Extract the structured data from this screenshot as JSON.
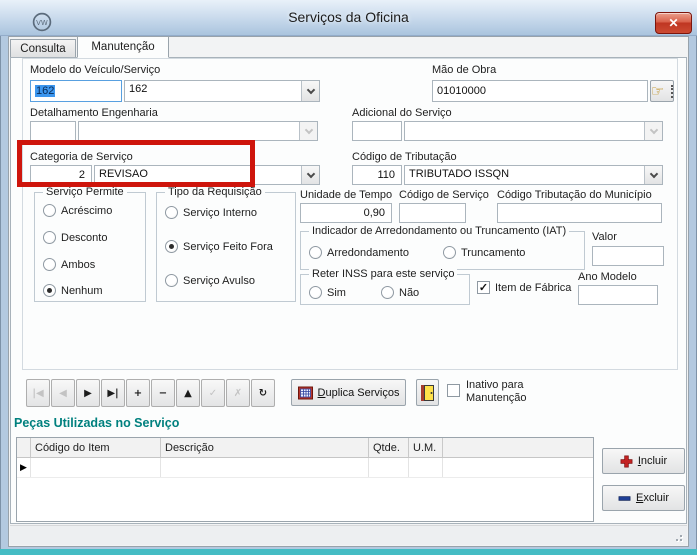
{
  "window": {
    "title": "Serviços da Oficina"
  },
  "tabs": {
    "consulta": "Consulta",
    "manutencao": "Manutenção"
  },
  "form": {
    "modelo": {
      "label": "Modelo do Veículo/Serviço",
      "code": "162",
      "name": "162"
    },
    "mao_de_obra": {
      "label": "Mão de Obra",
      "value": "01010000"
    },
    "detalhamento": {
      "label": "Detalhamento Engenharia",
      "code": "",
      "name": ""
    },
    "adicional": {
      "label": "Adicional do Serviço",
      "code": "",
      "name": ""
    },
    "categoria": {
      "label": "Categoria de Serviço",
      "code": "2",
      "name": "REVISAO"
    },
    "tributacao": {
      "label": "Código de Tributação",
      "code": "110",
      "name": "TRIBUTADO ISSQN"
    },
    "servico_permite": {
      "label": "Serviço Permite",
      "options": [
        "Acréscimo",
        "Desconto",
        "Ambos",
        "Nenhum"
      ],
      "selected": "Nenhum"
    },
    "tipo_requisicao": {
      "label": "Tipo da Requisição",
      "options": [
        "Serviço Interno",
        "Serviço Feito Fora",
        "Serviço Avulso"
      ],
      "selected": "Serviço Feito Fora"
    },
    "unidade_tempo": {
      "label": "Unidade de Tempo",
      "value": "0,90"
    },
    "codigo_servico": {
      "label": "Código de Serviço",
      "value": ""
    },
    "codigo_municipio": {
      "label": "Código Tributação do Município",
      "value": ""
    },
    "iat": {
      "label": "Indicador de Arredondamento ou Truncamento (IAT)",
      "options": [
        "Arredondamento",
        "Truncamento"
      ],
      "selected": ""
    },
    "valor": {
      "label": "Valor",
      "value": ""
    },
    "reter_inss": {
      "label": "Reter INSS para este serviço",
      "options": [
        "Sim",
        "Não"
      ],
      "selected": ""
    },
    "item_fabrica": {
      "label": "Item de Fábrica",
      "checked": true
    },
    "ano_modelo": {
      "label": "Ano Modelo",
      "value": ""
    }
  },
  "toolbar": {
    "nav": [
      {
        "name": "first",
        "glyph": "|◀",
        "enabled": false
      },
      {
        "name": "prior",
        "glyph": "◀",
        "enabled": false
      },
      {
        "name": "next",
        "glyph": "▶",
        "enabled": true
      },
      {
        "name": "last",
        "glyph": "▶|",
        "enabled": true
      },
      {
        "name": "insert",
        "glyph": "+",
        "enabled": true
      },
      {
        "name": "delete",
        "glyph": "−",
        "enabled": true
      },
      {
        "name": "edit",
        "glyph": "▲",
        "enabled": true
      },
      {
        "name": "post",
        "glyph": "✓",
        "enabled": false
      },
      {
        "name": "cancel",
        "glyph": "✗",
        "enabled": false
      },
      {
        "name": "refresh",
        "glyph": "↻",
        "enabled": true
      }
    ],
    "duplica_label": "Duplica Serviços",
    "inativo_label": "Inativo para Manutenção",
    "inativo_checked": false
  },
  "pecas": {
    "heading": "Peças Utilizadas no Serviço",
    "columns": [
      "Código do Item",
      "Descrição",
      "Qtde.",
      "U.M."
    ],
    "rows": [],
    "incluir_label": "Incluir",
    "excluir_label": "Excluir"
  },
  "colors": {
    "annotation_red": "#ce150c",
    "section_heading_teal": "#00807e",
    "selection_blue": "#3c96ee",
    "close_button_red": "#bf3622",
    "titlebar_blue": "#aac4de"
  }
}
